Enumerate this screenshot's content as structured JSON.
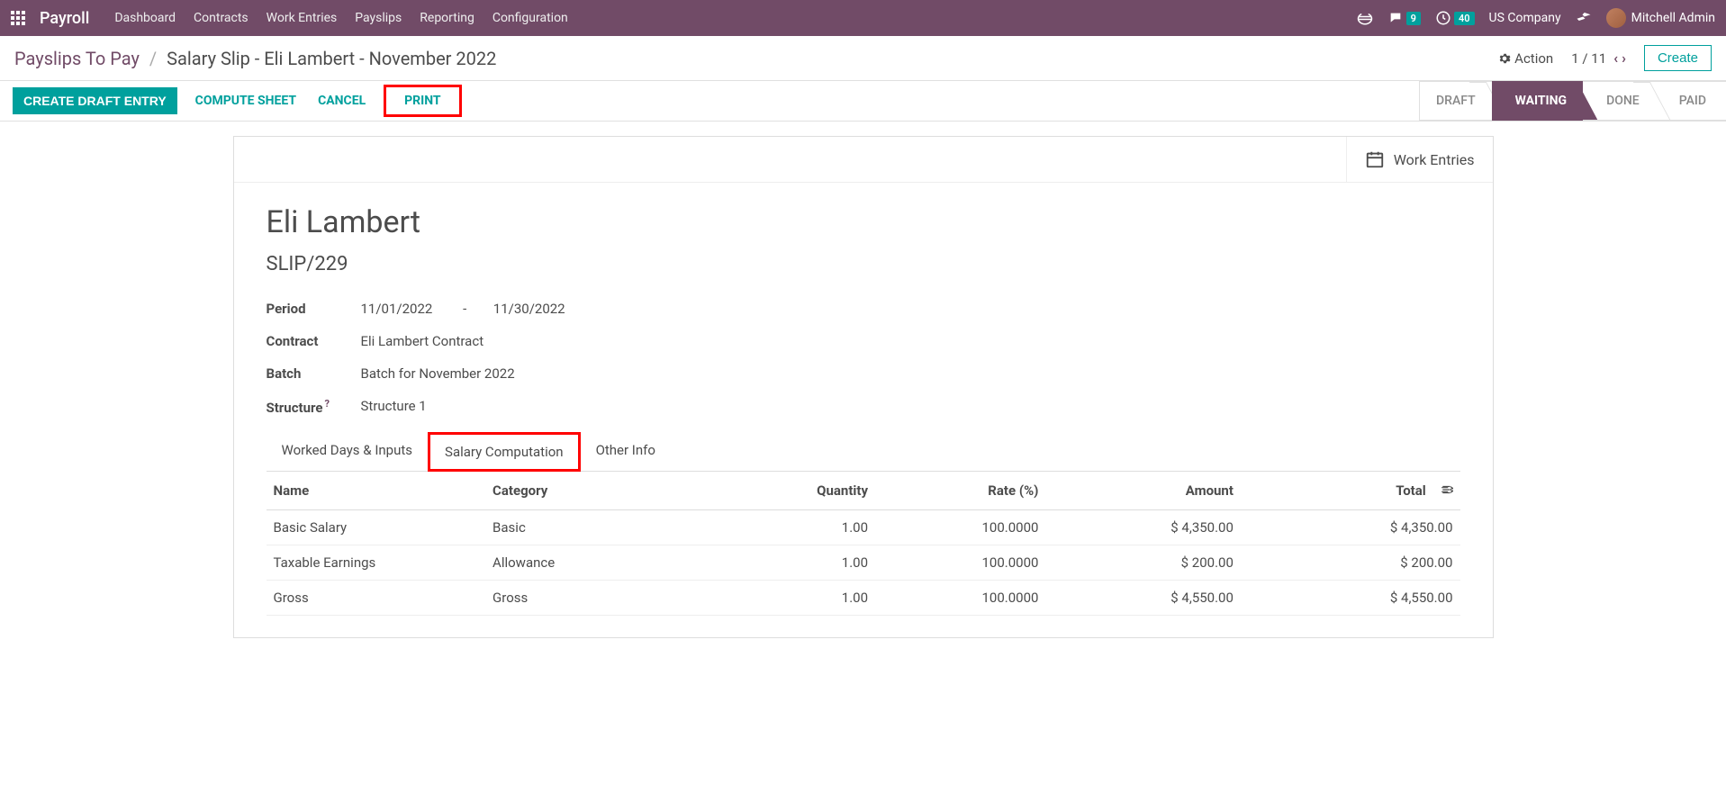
{
  "navbar": {
    "app": "Payroll",
    "menu": [
      "Dashboard",
      "Contracts",
      "Work Entries",
      "Payslips",
      "Reporting",
      "Configuration"
    ],
    "discuss_badge": "9",
    "activity_badge": "40",
    "company": "US Company",
    "user": "Mitchell Admin"
  },
  "breadcrumb": {
    "parent": "Payslips To Pay",
    "current": "Salary Slip - Eli Lambert - November 2022"
  },
  "controls": {
    "action": "Action",
    "pager": "1 / 11",
    "create": "Create"
  },
  "buttons": {
    "create_draft": "CREATE DRAFT ENTRY",
    "compute": "COMPUTE SHEET",
    "cancel": "CANCEL",
    "print": "PRINT"
  },
  "status_steps": [
    "DRAFT",
    "WAITING",
    "DONE",
    "PAID"
  ],
  "status_active": "WAITING",
  "sheet": {
    "stat_button": "Work Entries",
    "title": "Eli Lambert",
    "ref": "SLIP/229",
    "fields": {
      "period_label": "Period",
      "period_from": "11/01/2022",
      "period_to": "11/30/2022",
      "contract_label": "Contract",
      "contract": "Eli Lambert Contract",
      "batch_label": "Batch",
      "batch": "Batch for November 2022",
      "structure_label": "Structure",
      "structure": "Structure 1"
    },
    "tabs": [
      "Worked Days & Inputs",
      "Salary Computation",
      "Other Info"
    ],
    "active_tab": "Salary Computation"
  },
  "chart_data": {
    "type": "table",
    "columns": [
      "Name",
      "Category",
      "Quantity",
      "Rate (%)",
      "Amount",
      "Total"
    ],
    "rows": [
      {
        "name": "Basic Salary",
        "category": "Basic",
        "quantity": "1.00",
        "rate": "100.0000",
        "amount": "$ 4,350.00",
        "total": "$ 4,350.00"
      },
      {
        "name": "Taxable Earnings",
        "category": "Allowance",
        "quantity": "1.00",
        "rate": "100.0000",
        "amount": "$ 200.00",
        "total": "$ 200.00"
      },
      {
        "name": "Gross",
        "category": "Gross",
        "quantity": "1.00",
        "rate": "100.0000",
        "amount": "$ 4,550.00",
        "total": "$ 4,550.00"
      }
    ]
  }
}
